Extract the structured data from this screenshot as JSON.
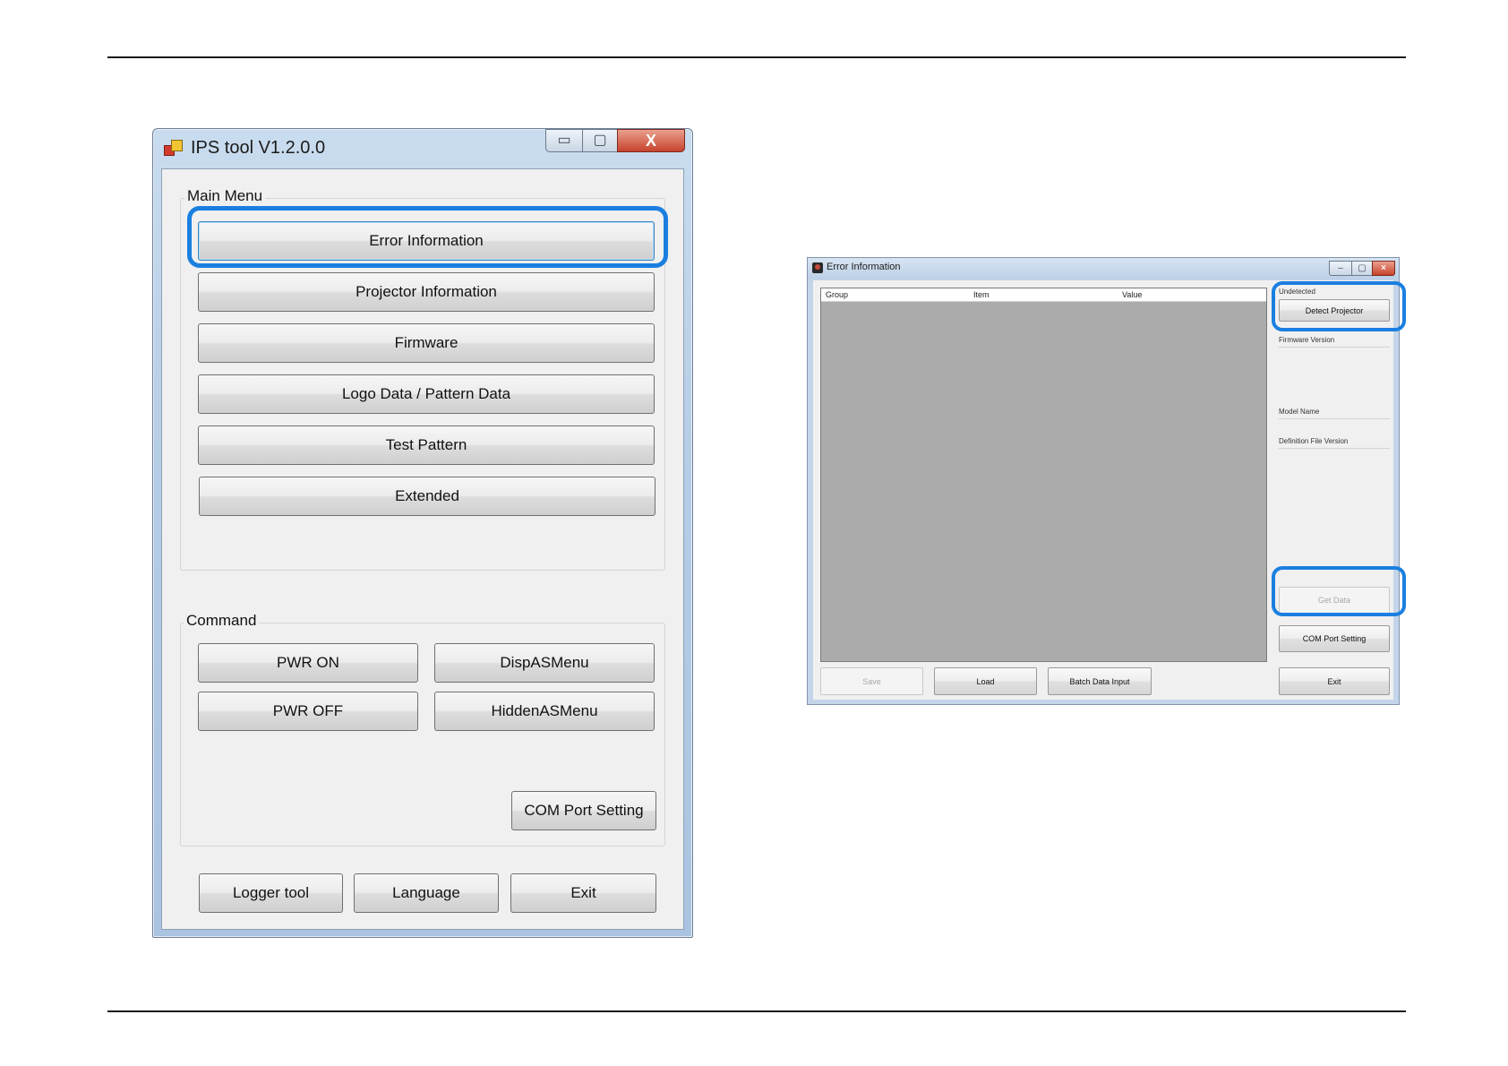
{
  "ips_tool": {
    "title": "IPS tool V1.2.0.0",
    "title_controls": {
      "minimize": "▭",
      "maximize": "▢",
      "close": "X"
    },
    "main_menu": {
      "label": "Main Menu",
      "buttons": [
        "Error Information",
        "Projector Information",
        "Firmware",
        "Logo Data / Pattern Data",
        "Test Pattern",
        "Extended"
      ]
    },
    "command": {
      "label": "Command",
      "buttons": [
        "PWR ON",
        "DispASMenu",
        "PWR OFF",
        "HiddenASMenu"
      ],
      "com_port": "COM Port Setting"
    },
    "footer": [
      "Logger tool",
      "Language",
      "Exit"
    ]
  },
  "error_info": {
    "title": "Error Information",
    "title_controls": {
      "minimize": "–",
      "maximize": "▢",
      "close": "×"
    },
    "columns": [
      "Group",
      "Item",
      "Value"
    ],
    "status": "Undetected",
    "detect_button": "Detect Projector",
    "fields": {
      "firmware": "Firmware Version",
      "model": "Model Name",
      "definition": "Definition File Version"
    },
    "get_data": "Get Data",
    "com_port": "COM Port Setting",
    "bottom_buttons": [
      "Save",
      "Load",
      "Batch Data Input"
    ],
    "exit": "Exit"
  },
  "colors": {
    "highlight": "#1a7fe0",
    "grid_background": "#ababab"
  }
}
